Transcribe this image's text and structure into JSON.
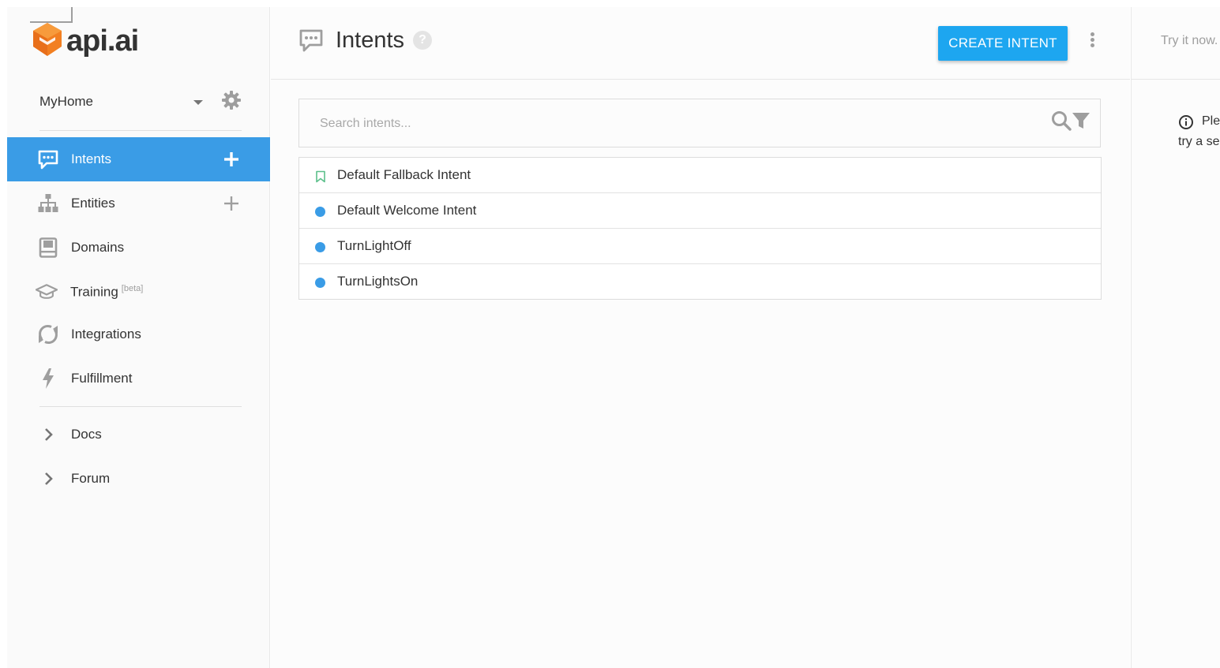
{
  "brand": {
    "name": "api.ai"
  },
  "agent": {
    "name": "MyHome"
  },
  "nav": {
    "items": [
      {
        "label": "Intents",
        "icon": "chat-bubble-icon",
        "active": true,
        "has_add": true
      },
      {
        "label": "Entities",
        "icon": "sitemap-icon",
        "has_add": true
      },
      {
        "label": "Domains",
        "icon": "book-icon"
      },
      {
        "label": "Training",
        "sup": "[beta]",
        "icon": "graduation-cap-icon"
      },
      {
        "label": "Integrations",
        "icon": "sync-icon"
      },
      {
        "label": "Fulfillment",
        "icon": "lightning-icon"
      }
    ],
    "links": [
      {
        "label": "Docs",
        "icon": "chevron-right-icon"
      },
      {
        "label": "Forum",
        "icon": "chevron-right-icon"
      }
    ]
  },
  "header": {
    "title": "Intents",
    "help": "?",
    "create_label": "CREATE INTENT"
  },
  "search": {
    "placeholder": "Search intents..."
  },
  "intents": [
    {
      "name": "Default Fallback Intent",
      "marker": "bookmark"
    },
    {
      "name": "Default Welcome Intent",
      "marker": "dot"
    },
    {
      "name": "TurnLightOff",
      "marker": "dot"
    },
    {
      "name": "TurnLightsOn",
      "marker": "dot"
    }
  ],
  "right_panel": {
    "try_label": "Try it now.",
    "info_line1": "Ple",
    "info_line2": "try a se"
  },
  "colors": {
    "accent": "#3a9ce6",
    "button": "#1da6f0",
    "logo": "#f27f21"
  }
}
